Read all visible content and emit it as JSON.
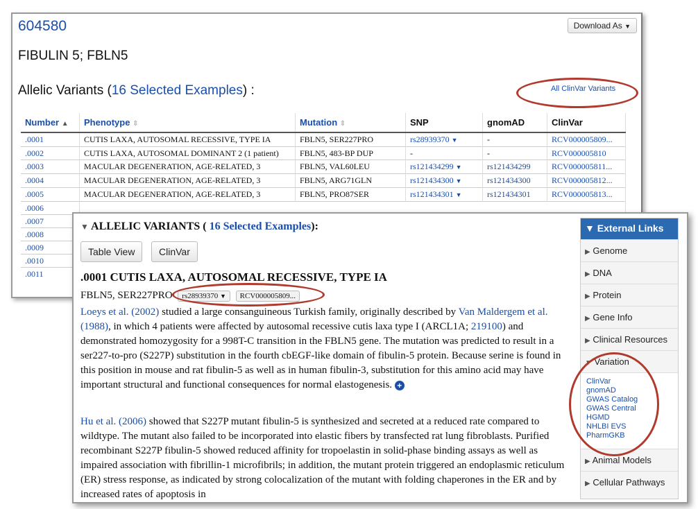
{
  "back": {
    "mim": "604580",
    "download": "Download As",
    "gene_title": "FIBULIN 5; FBLN5",
    "variants_title_pre": "Allelic Variants (",
    "variants_count": "16 Selected Examples",
    "variants_title_post": ") :",
    "all_clinvar": "All ClinVar Variants",
    "headers": [
      "Number",
      "Phenotype",
      "Mutation",
      "SNP",
      "gnomAD",
      "ClinVar"
    ],
    "rows": [
      {
        "num": ".0001",
        "pheno": "CUTIS LAXA, AUTOSOMAL RECESSIVE, TYPE IA",
        "mut": "FBLN5, SER227PRO",
        "snp": "rs28939370",
        "gnomad": "-",
        "clinvar": "RCV000005809..."
      },
      {
        "num": ".0002",
        "pheno": "CUTIS LAXA, AUTOSOMAL DOMINANT 2 (1 patient)",
        "mut": "FBLN5, 483-BP DUP",
        "snp": "-",
        "gnomad": "-",
        "clinvar": "RCV000005810"
      },
      {
        "num": ".0003",
        "pheno": "MACULAR DEGENERATION, AGE-RELATED, 3",
        "mut": "FBLN5, VAL60LEU",
        "snp": "rs121434299",
        "gnomad": "rs121434299",
        "clinvar": "RCV000005811..."
      },
      {
        "num": ".0004",
        "pheno": "MACULAR DEGENERATION, AGE-RELATED, 3",
        "mut": "FBLN5, ARG71GLN",
        "snp": "rs121434300",
        "gnomad": "rs121434300",
        "clinvar": "RCV000005812..."
      },
      {
        "num": ".0005",
        "pheno": "MACULAR DEGENERATION, AGE-RELATED, 3",
        "mut": "FBLN5, PRO87SER",
        "snp": "rs121434301",
        "gnomad": "rs121434301",
        "clinvar": "RCV000005813..."
      }
    ],
    "more_nums": [
      ".0006",
      ".0007",
      ".0008",
      ".0009",
      ".0010",
      ".0011"
    ]
  },
  "front": {
    "av_header_pre": "ALLELIC VARIANTS (",
    "av_header_count": "16 Selected Examples",
    "av_header_post": "):",
    "btn_table": "Table View",
    "btn_clinvar": "ClinVar",
    "entry_title": ".0001 CUTIS LAXA, AUTOSOMAL RECESSIVE, TYPE IA",
    "mutation": "FBLN5, SER227PRO",
    "snp_chip": "rs28939370",
    "rcv_chip": "RCV000005809...",
    "p1": {
      "link1": "Loeys et al. (2002)",
      "t1": " studied a large consanguineous Turkish family, originally described by ",
      "link2": "Van Maldergem et al. (1988)",
      "t2": ", in which 4 patients were affected by autosomal recessive cutis laxa type I (ARCL1A; ",
      "link3": "219100",
      "t3": ") and demonstrated homozygosity for a 998T-C transition in the FBLN5 gene. The mutation was predicted to result in a ser227-to-pro (S227P) substitution in the fourth cbEGF-like domain of fibulin-5 protein. Because serine is found in this position in mouse and rat fibulin-5 as well as in human fibulin-3, substitution for this amino acid may have important structural and functional consequences for normal elastogenesis."
    },
    "p2": {
      "link1": "Hu et al. (2006)",
      "t1": " showed that S227P mutant fibulin-5 is synthesized and secreted at a reduced rate compared to wildtype. The mutant also failed to be incorporated into elastic fibers by transfected rat lung fibroblasts. Purified recombinant S227P fibulin-5 showed reduced affinity for tropoelastin in solid-phase binding assays as well as impaired association with fibrillin-1 microfibrils; in addition, the mutant protein triggered an endoplasmic reticulum (ER) stress response, as indicated by strong colocalization of the mutant with folding chaperones in the ER and by increased rates of apoptosis in"
    },
    "sidebar": {
      "header": "External Links",
      "items_top": [
        "Genome",
        "DNA",
        "Protein",
        "Gene Info",
        "Clinical Resources"
      ],
      "variation": "Variation",
      "variation_links": [
        "ClinVar",
        "gnomAD",
        "GWAS Catalog",
        "GWAS Central",
        "HGMD",
        "NHLBI EVS",
        "PharmGKB"
      ],
      "items_bottom": [
        "Animal Models",
        "Cellular Pathways"
      ]
    }
  },
  "colors": {
    "link": "#1a4ea8",
    "sidebar_header": "#2b69b0",
    "annotation": "#b03a2e"
  }
}
